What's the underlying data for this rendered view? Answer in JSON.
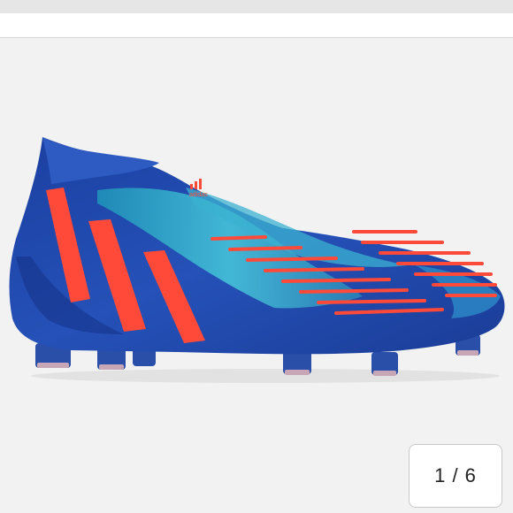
{
  "gallery": {
    "counter_text": "1 / 6",
    "current_index": 1,
    "total_images": 6
  },
  "product_image": {
    "subject": "football-boot-icon",
    "brand_text": "adidas"
  },
  "colors": {
    "boot_blue": "#1e47a8",
    "boot_teal": "#2fa3c4",
    "stripe_red": "#ff4a3a"
  }
}
